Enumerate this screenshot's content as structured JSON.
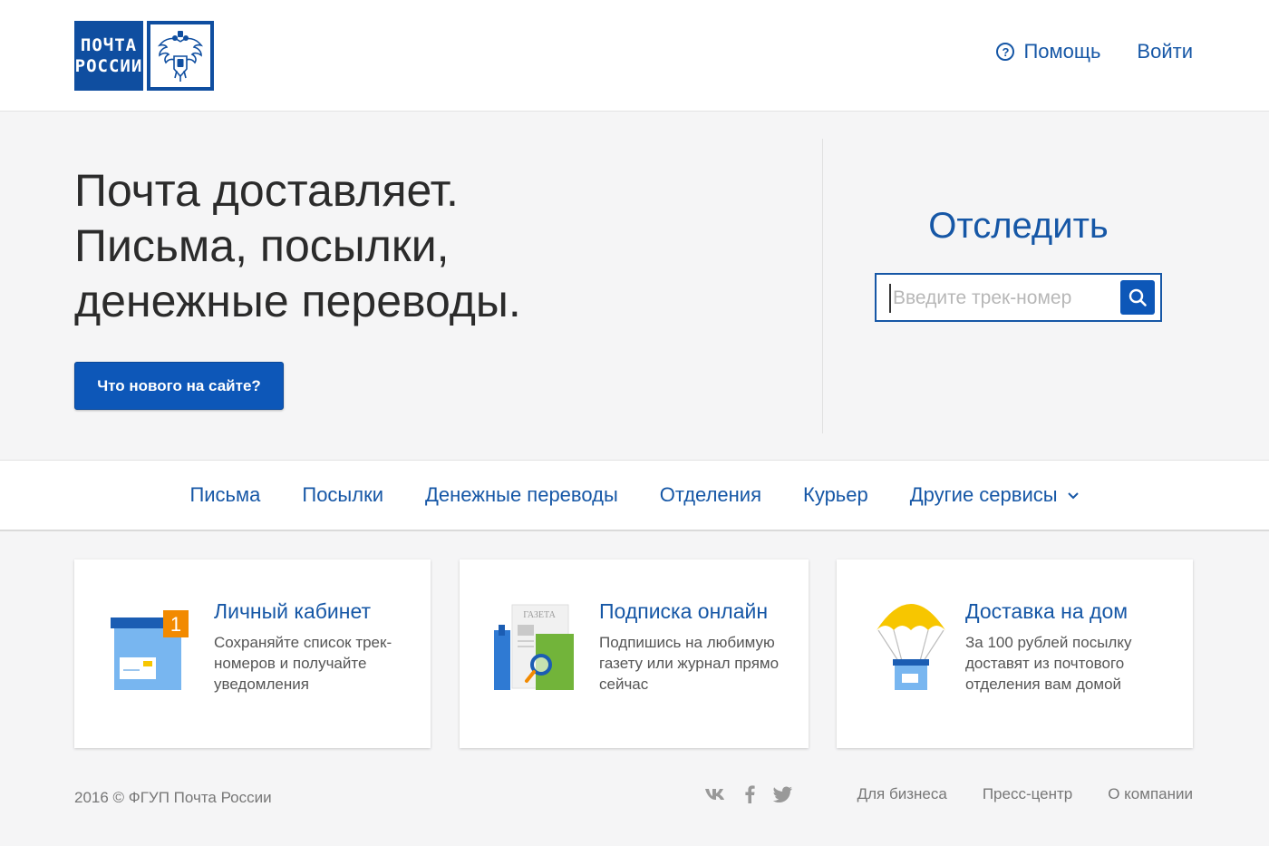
{
  "header": {
    "logo_line1": "ПОЧТА",
    "logo_line2": "РОССИИ",
    "help_label": "Помощь",
    "help_glyph": "?",
    "login_label": "Войти"
  },
  "hero": {
    "title_lines": [
      "Почта доставляет.",
      "Письма, посылки,",
      "денежные переводы."
    ],
    "whats_new_label": "Что нового на сайте?"
  },
  "tracking": {
    "title": "Отследить",
    "placeholder": "Введите трек-номер",
    "value": ""
  },
  "nav": {
    "items": [
      "Письма",
      "Посылки",
      "Денежные переводы",
      "Отделения",
      "Курьер",
      "Другие сервисы"
    ]
  },
  "cards": [
    {
      "title": "Личный кабинет",
      "description": "Сохраняйте список трек-номеров и получайте уведомления",
      "badge": "1",
      "icon": "mailbox-icon"
    },
    {
      "title": "Подписка онлайн",
      "description": "Подпишись на любимую газету или журнал прямо сейчас",
      "newspaper_label": "ГАЗЕТА",
      "icon": "newspaper-icon"
    },
    {
      "title": "Доставка на дом",
      "description": "За 100 рублей посылку доставят из почтового отделения вам домой",
      "icon": "parachute-parcel-icon"
    }
  ],
  "footer": {
    "copyright": "2016 © ФГУП Почта России",
    "links": [
      "Для бизнеса",
      "Пресс-центр",
      "О компании"
    ],
    "social_icons": [
      "vk-icon",
      "facebook-icon",
      "twitter-icon"
    ]
  },
  "colors": {
    "brand_blue": "#0f4ea0",
    "link_blue": "#1657a6",
    "button_blue": "#0d57b8",
    "badge_orange": "#f28a00",
    "parachute_yellow": "#f7c600"
  }
}
